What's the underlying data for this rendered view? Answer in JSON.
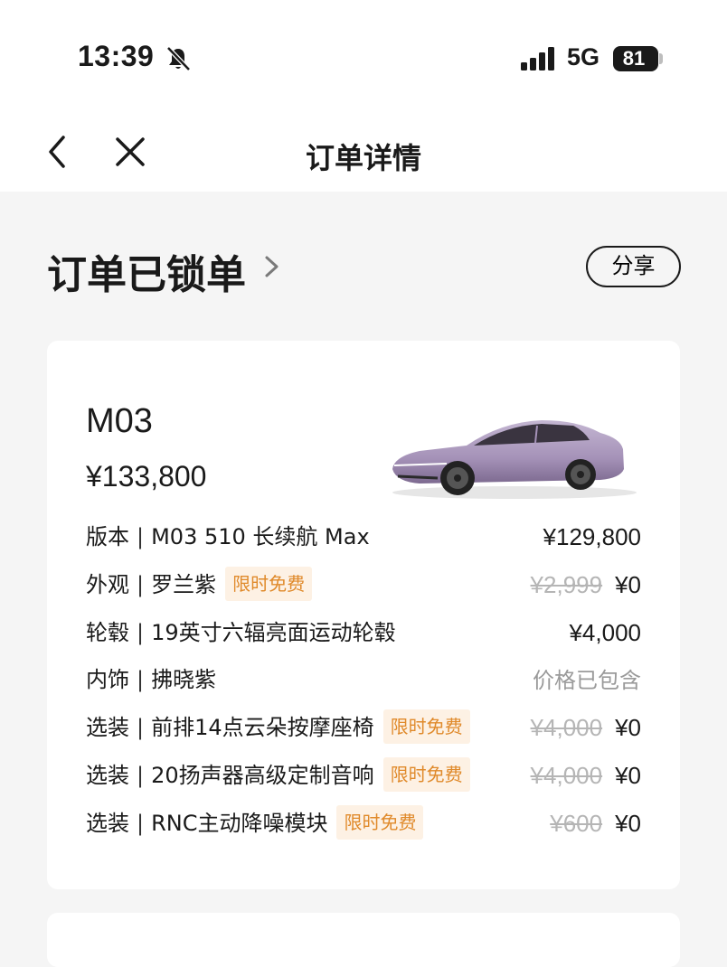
{
  "status_bar": {
    "time": "13:39",
    "network": "5G",
    "battery": "81"
  },
  "nav": {
    "title": "订单详情"
  },
  "order": {
    "status": "订单已锁单",
    "share_label": "分享"
  },
  "car": {
    "model": "M03",
    "total_price": "¥133,800",
    "color_hex": "#a796b7"
  },
  "specs": [
    {
      "category": "版本",
      "value": "M03 510 长续航 Max",
      "badge": "",
      "old_price": "",
      "price": "¥129,800"
    },
    {
      "category": "外观",
      "value": "罗兰紫",
      "badge": "限时免费",
      "old_price": "¥2,999",
      "price": "¥0"
    },
    {
      "category": "轮毂",
      "value": "19英寸六辐亮面运动轮毂",
      "badge": "",
      "old_price": "",
      "price": "¥4,000"
    },
    {
      "category": "内饰",
      "value": "拂晓紫",
      "badge": "",
      "old_price": "",
      "price": "价格已包含"
    },
    {
      "category": "选装",
      "value": "前排14点云朵按摩座椅",
      "badge": "限时免费",
      "old_price": "¥4,000",
      "price": "¥0"
    },
    {
      "category": "选装",
      "value": "20扬声器高级定制音响",
      "badge": "限时免费",
      "old_price": "¥4,000",
      "price": "¥0"
    },
    {
      "category": "选装",
      "value": "RNC主动降噪模块",
      "badge": "限时免费",
      "old_price": "¥600",
      "price": "¥0"
    }
  ],
  "colors": {
    "badge_bg": "#fdf1e4",
    "badge_text": "#e08a2b",
    "page_bg": "#f5f5f5"
  }
}
